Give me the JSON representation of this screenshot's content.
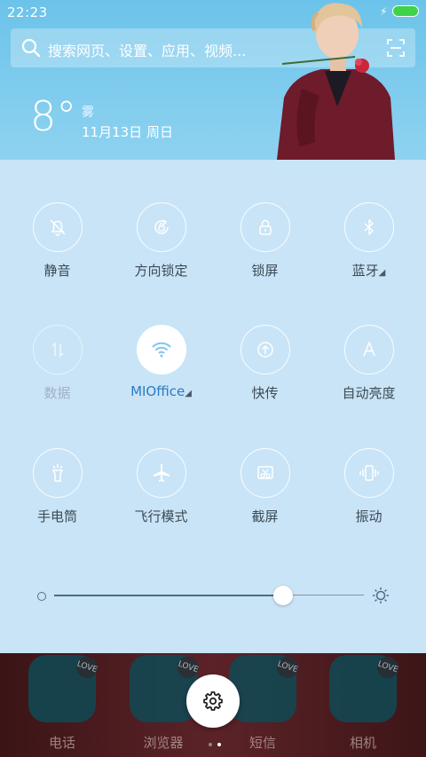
{
  "status_bar": {
    "time": "22:23"
  },
  "search": {
    "placeholder": "搜索网页、设置、应用、视频..."
  },
  "weather": {
    "temperature": "8°",
    "condition": "雾",
    "date": "11月13日 周日"
  },
  "toggles": [
    {
      "label": "静音",
      "icon": "bell-off-icon",
      "state": "off"
    },
    {
      "label": "方向锁定",
      "icon": "rotation-lock-icon",
      "state": "off"
    },
    {
      "label": "锁屏",
      "icon": "lock-icon",
      "state": "off"
    },
    {
      "label": "蓝牙",
      "icon": "bluetooth-icon",
      "state": "off"
    },
    {
      "label": "数据",
      "icon": "mobile-data-icon",
      "state": "disabled"
    },
    {
      "label": "MIOffice",
      "icon": "wifi-icon",
      "state": "on"
    },
    {
      "label": "快传",
      "icon": "share-icon",
      "state": "off"
    },
    {
      "label": "自动亮度",
      "icon": "auto-brightness-icon",
      "state": "off"
    },
    {
      "label": "手电筒",
      "icon": "flashlight-icon",
      "state": "off"
    },
    {
      "label": "飞行模式",
      "icon": "airplane-icon",
      "state": "off"
    },
    {
      "label": "截屏",
      "icon": "screenshot-icon",
      "state": "off"
    },
    {
      "label": "振动",
      "icon": "vibrate-icon",
      "state": "off"
    }
  ],
  "brightness": {
    "level": 0.74
  },
  "dock": {
    "apps": [
      {
        "label": "电话",
        "icon": "phone-icon"
      },
      {
        "label": "浏览器",
        "icon": "browser-icon"
      },
      {
        "label": "短信",
        "icon": "messages-icon"
      },
      {
        "label": "相机",
        "icon": "camera-icon"
      }
    ],
    "badge": "LOVE"
  },
  "colors": {
    "header": "#6cc3ea",
    "panel": "#c9e4f6",
    "active_label": "#2a7bc4"
  }
}
